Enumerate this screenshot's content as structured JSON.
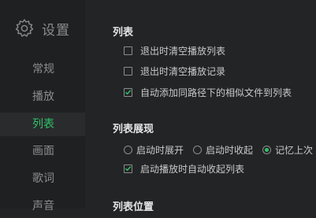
{
  "sidebar": {
    "title": "设置",
    "items": [
      {
        "label": "常规"
      },
      {
        "label": "播放"
      },
      {
        "label": "列表"
      },
      {
        "label": "画面"
      },
      {
        "label": "歌词"
      },
      {
        "label": "声音"
      }
    ],
    "active_index": 2
  },
  "sections": {
    "list": {
      "title": "列表",
      "options": [
        {
          "label": "退出时清空播放列表",
          "checked": false
        },
        {
          "label": "退出时清空播放记录",
          "checked": false
        },
        {
          "label": "自动添加同路径下的相似文件到列表",
          "checked": true
        }
      ]
    },
    "display": {
      "title": "列表展现",
      "radios": [
        {
          "label": "启动时展开",
          "selected": false
        },
        {
          "label": "启动时收起",
          "selected": false
        },
        {
          "label": "记忆上次",
          "selected": true
        }
      ],
      "option": {
        "label": "启动播放时自动收起列表",
        "checked": true
      }
    },
    "position": {
      "title": "列表位置"
    }
  },
  "colors": {
    "accent": "#2ec36a",
    "background": "#232426",
    "sidebar": "#1f2022"
  }
}
